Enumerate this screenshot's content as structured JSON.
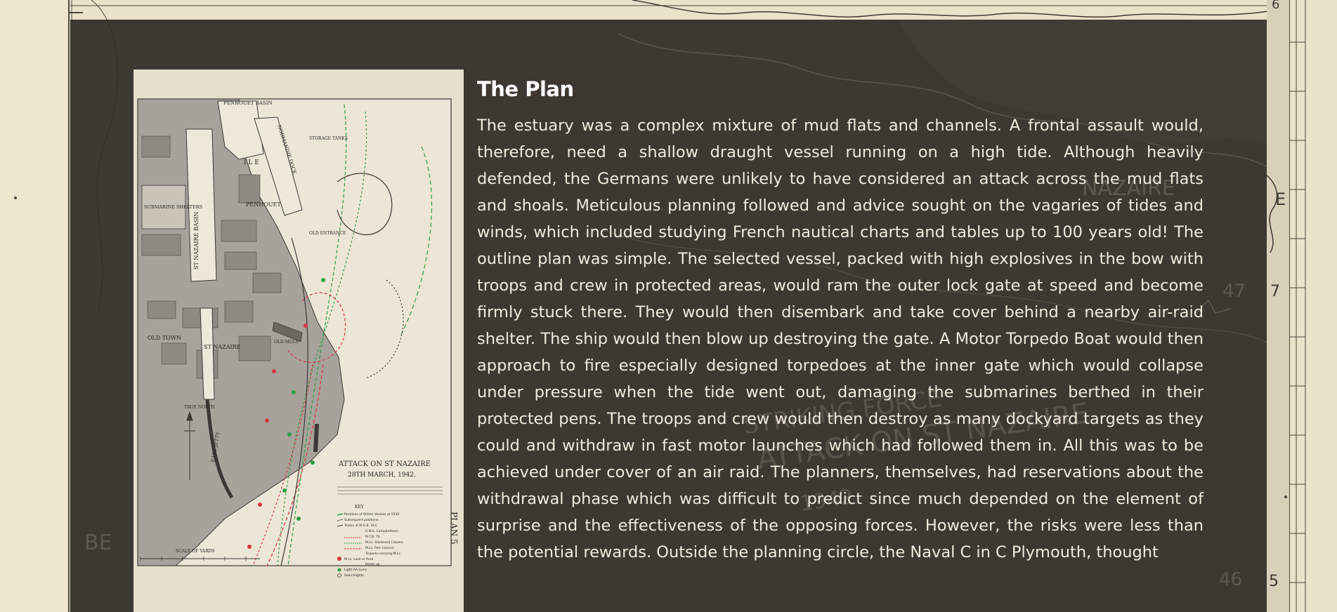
{
  "article": {
    "title": "The Plan",
    "body": "The estuary was a complex mixture of mud flats and channels. A frontal assault would, therefore, need a shallow draught vessel running on a high tide. Although heavily defended, the Germans were unlikely to have considered an attack across the mud flats and shoals. Meticulous planning followed and advice sought on the vagaries of tides and winds, which included studying French nautical charts and tables up to 100 years old! The outline plan was simple. The selected vessel, packed with high explosives in the bow with troops and crew in protected areas, would ram the outer lock gate at speed and become firmly stuck there. They would then disembark and take cover behind a nearby air-raid shelter. The ship would then blow up destroying the gate. A Motor Torpedo Boat would then approach to fire especially designed torpedoes at the inner gate which would collapse under pressure when the tide went out, damaging the submarines berthed in their protected pens. The troops and crew would then destroy as many dockyard targets as they could and withdraw in fast motor launches which had followed them in. All this was to be achieved under cover of an air raid. The planners, themselves, had reservations about the withdrawal phase which was difficult to predict since much depended on the element of surprise and the effectiveness of the opposing forces. However, the risks were less than the potential rewards. Outside the planning circle, the Naval C in C Plymouth, thought"
  },
  "map": {
    "title": "ATTACK ON ST NAZAIRE",
    "date": "28TH MARCH, 1942.",
    "plan_label": "PLAN 5",
    "scale_label": "SCALE OF YARDS",
    "north_label": "TRUE NORTH",
    "places": {
      "penhouet_basin": "PENHOUET BASIN",
      "ile": "I L E",
      "penhouet": "PENHOUET",
      "submarine_shelters": "SUBMARINE SHELTERS",
      "st_nazaire_basin": "ST NAZAIRE BASIN",
      "old_town": "OLD TOWN",
      "st_nazaire": "ST NAZAIRE",
      "old_mole": "OLD MOLE",
      "normandie_dock": "NORMANDIE DOCK",
      "old_entrance": "OLD ENTRANCE",
      "storage_tanks": "STORAGE TANKS",
      "east_jetty": "EAST JETTY"
    },
    "key_title": "KEY",
    "key_items": [
      "Positions of British Vessels at 0130",
      "Subsequent positions",
      "Tracks of M.G.B. 314.",
      "H.M.S. Campbeltown",
      "M.T.B. 74.",
      "M.Ls. Starboard Column",
      "M.Ls. Port Column",
      "Torpedo-carrying M.Ls.",
      "M.Ls. sunk or fired",
      "blown up",
      "Light AA Guns",
      "Searchlights"
    ]
  },
  "background": {
    "labels": [
      "NAZAIRE",
      "BE",
      "47",
      "46",
      "ATTACK ON ST NAZAIRE",
      "STRIKING FORCE",
      "1942"
    ]
  },
  "colors": {
    "panel": "#2f2b26",
    "paper": "#e9dfc8",
    "map_red": "#d9363e",
    "map_green": "#2f9e44"
  }
}
